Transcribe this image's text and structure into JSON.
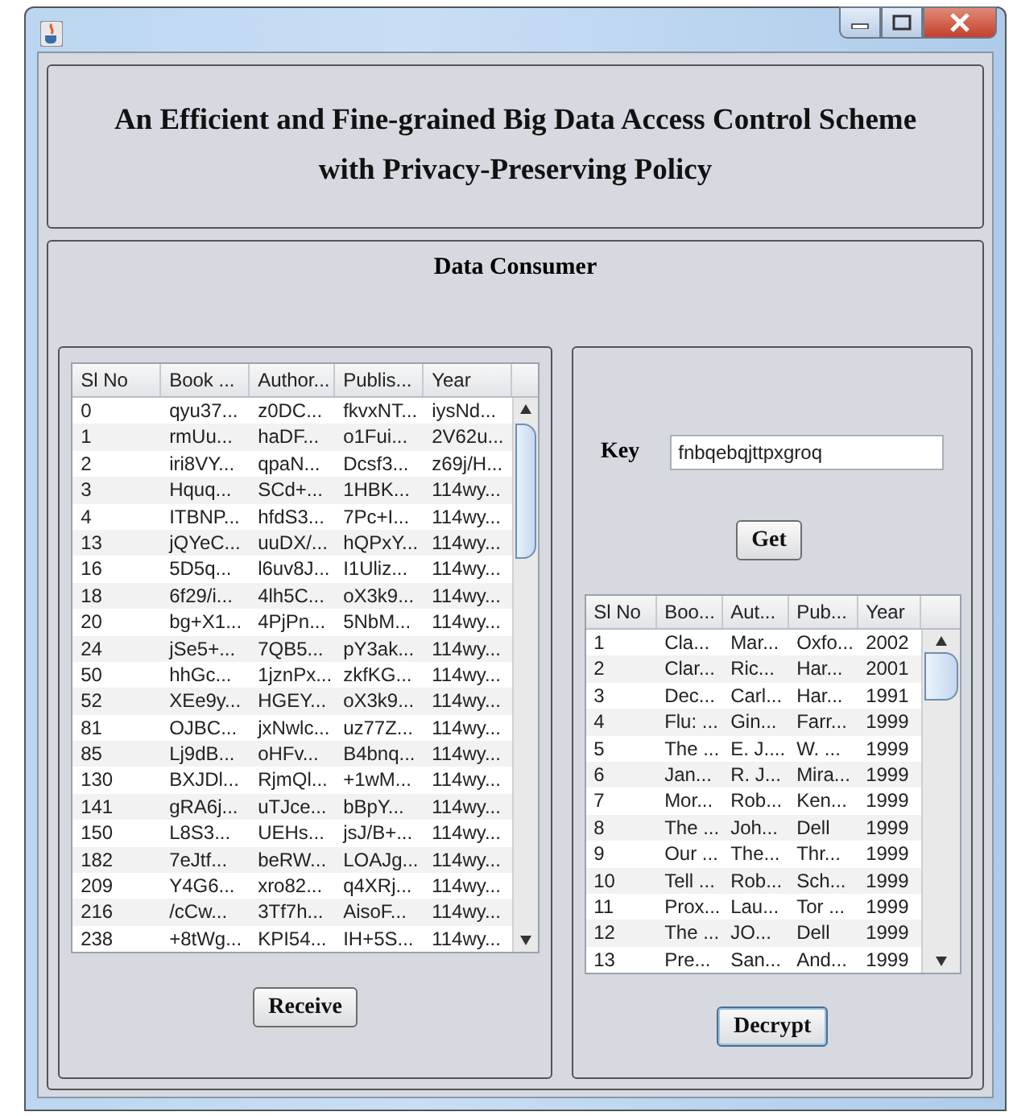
{
  "heading": {
    "line_1": "An Efficient and Fine-grained Big Data Access Control Scheme",
    "line_2": "with Privacy-Preserving Policy"
  },
  "panel_title": "Data Consumer",
  "left_table": {
    "columns": [
      "Sl No",
      "Book ...",
      "Author...",
      "Publis...",
      "Year"
    ],
    "rows": [
      [
        "0",
        "qyu37...",
        "z0DC...",
        "fkvxNT...",
        "iysNd..."
      ],
      [
        "1",
        "rmUu...",
        "haDF...",
        "o1Fui...",
        "2V62u..."
      ],
      [
        "2",
        "iri8VY...",
        "qpaN...",
        "Dcsf3...",
        "z69j/H..."
      ],
      [
        "3",
        "Hquq...",
        "SCd+...",
        "1HBK...",
        "114wy..."
      ],
      [
        "4",
        "ITBNP...",
        "hfdS3...",
        "7Pc+I...",
        "114wy..."
      ],
      [
        "13",
        "jQYeC...",
        "uuDX/...",
        "hQPxY...",
        "114wy..."
      ],
      [
        "16",
        "5D5q...",
        "l6uv8J...",
        "I1Uliz...",
        "114wy..."
      ],
      [
        "18",
        "6f29/i...",
        "4lh5C...",
        "oX3k9...",
        "114wy..."
      ],
      [
        "20",
        "bg+X1...",
        "4PjPn...",
        "5NbM...",
        "114wy..."
      ],
      [
        "24",
        "jSe5+...",
        "7QB5...",
        "pY3ak...",
        "114wy..."
      ],
      [
        "50",
        "hhGc...",
        "1jznPx...",
        "zkfKG...",
        "114wy..."
      ],
      [
        "52",
        "XEe9y...",
        "HGEY...",
        "oX3k9...",
        "114wy..."
      ],
      [
        "81",
        "OJBC...",
        "jxNwlc...",
        "uz77Z...",
        "114wy..."
      ],
      [
        "85",
        "Lj9dB...",
        "oHFv...",
        "B4bnq...",
        "114wy..."
      ],
      [
        "130",
        "BXJDl...",
        "RjmQl...",
        "+1wM...",
        "114wy..."
      ],
      [
        "141",
        "gRA6j...",
        "uTJce...",
        "bBpY...",
        "114wy..."
      ],
      [
        "150",
        "L8S3...",
        "UEHs...",
        "jsJ/B+...",
        "114wy..."
      ],
      [
        "182",
        "7eJtf...",
        "beRW...",
        "LOAJg...",
        "114wy..."
      ],
      [
        "209",
        "Y4G6...",
        "xro82...",
        "q4XRj...",
        "114wy..."
      ],
      [
        "216",
        "/cCw...",
        "3Tf7h...",
        "AisoF...",
        "114wy..."
      ],
      [
        "238",
        "+8tWg...",
        "KPI54...",
        "IH+5S...",
        "114wy..."
      ]
    ]
  },
  "receive_button": "Receive",
  "key": {
    "label": "Key",
    "value": "fnbqebqjttpxgroq"
  },
  "get_button": "Get",
  "right_table": {
    "columns": [
      "Sl No",
      "Boo...",
      "Aut...",
      "Pub...",
      "Year"
    ],
    "rows": [
      [
        "1",
        "Cla...",
        "Mar...",
        "Oxfo...",
        "2002"
      ],
      [
        "2",
        "Clar...",
        "Ric...",
        "Har...",
        "2001"
      ],
      [
        "3",
        "Dec...",
        "Carl...",
        "Har...",
        "1991"
      ],
      [
        "4",
        "Flu: ...",
        "Gin...",
        "Farr...",
        "1999"
      ],
      [
        "5",
        "The ...",
        "E. J....",
        "W. ...",
        "1999"
      ],
      [
        "6",
        "Jan...",
        "R. J...",
        "Mira...",
        "1999"
      ],
      [
        "7",
        "Mor...",
        "Rob...",
        "Ken...",
        "1999"
      ],
      [
        "8",
        "The ...",
        "Joh...",
        "Dell",
        "1999"
      ],
      [
        "9",
        "Our ...",
        "The...",
        "Thr...",
        "1999"
      ],
      [
        "10",
        "Tell ...",
        "Rob...",
        "Sch...",
        "1999"
      ],
      [
        "11",
        "Prox...",
        "Lau...",
        "Tor ...",
        "1999"
      ],
      [
        "12",
        "The ...",
        "JO...",
        "Dell",
        "1999"
      ],
      [
        "13",
        "Pre...",
        "San...",
        "And...",
        "1999"
      ]
    ]
  },
  "decrypt_button": "Decrypt"
}
